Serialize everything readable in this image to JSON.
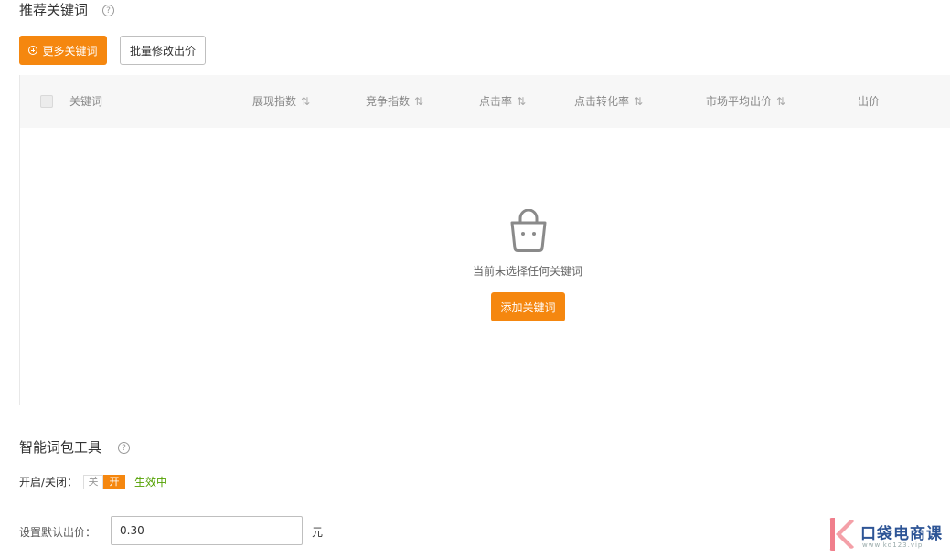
{
  "recommend": {
    "title": "推荐关键词",
    "help": "?",
    "more_keywords_label": "更多关键词",
    "batch_bid_label": "批量修改出价"
  },
  "table": {
    "columns": [
      {
        "label": "关键词",
        "sortable": false
      },
      {
        "label": "展现指数",
        "sortable": true
      },
      {
        "label": "竞争指数",
        "sortable": true
      },
      {
        "label": "点击率",
        "sortable": true
      },
      {
        "label": "点击转化率",
        "sortable": true
      },
      {
        "label": "市场平均出价",
        "sortable": true
      },
      {
        "label": "出价",
        "sortable": false
      }
    ],
    "sort_glyph": "⇅",
    "empty_text": "当前未选择任何关键词",
    "add_keyword_label": "添加关键词"
  },
  "smart": {
    "title": "智能词包工具",
    "help": "?",
    "toggle_label": "开启/关闭：",
    "off_label": "关",
    "on_label": "开",
    "status_text": "生效中",
    "default_bid_label": "设置默认出价：",
    "default_bid_value": "0.30",
    "unit": "元"
  },
  "watermark": {
    "text": "口袋电商课",
    "sub": "www.kd123.vip"
  },
  "colors": {
    "accent": "#f5870f",
    "status_green": "#52a100",
    "header_bg": "#f7f7f7"
  }
}
